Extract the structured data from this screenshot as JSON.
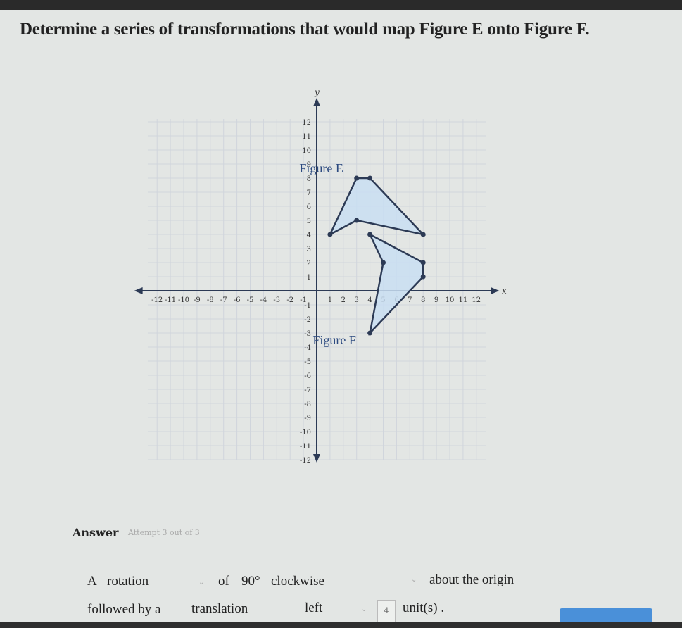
{
  "question": {
    "title": "Determine a series of transformations that would map Figure E onto Figure F."
  },
  "graph": {
    "x_axis_label": "x",
    "y_axis_label": "y",
    "range": [
      -12,
      12
    ],
    "grid": true,
    "fill_color": "#c9def2",
    "line_color": "#2c3a55",
    "figure_e": {
      "label": "Figure E",
      "vertices": [
        [
          1,
          4
        ],
        [
          3,
          8
        ],
        [
          4,
          8
        ],
        [
          8,
          4
        ],
        [
          3,
          5
        ]
      ]
    },
    "figure_f": {
      "label": "Figure F",
      "vertices": [
        [
          4,
          4
        ],
        [
          8,
          2
        ],
        [
          8,
          1
        ],
        [
          4,
          -3
        ],
        [
          5,
          2
        ]
      ]
    }
  },
  "answer": {
    "label": "Answer",
    "attempt": "Attempt 3 out of 3",
    "row1": {
      "prefix": "A",
      "transformation": "rotation",
      "of": "of",
      "angle": "90°",
      "direction": "clockwise",
      "suffix": "about the origin"
    },
    "row2": {
      "prefix": "followed by a",
      "transformation": "translation",
      "direction": "left",
      "units": "4",
      "suffix": "unit(s) ."
    }
  }
}
